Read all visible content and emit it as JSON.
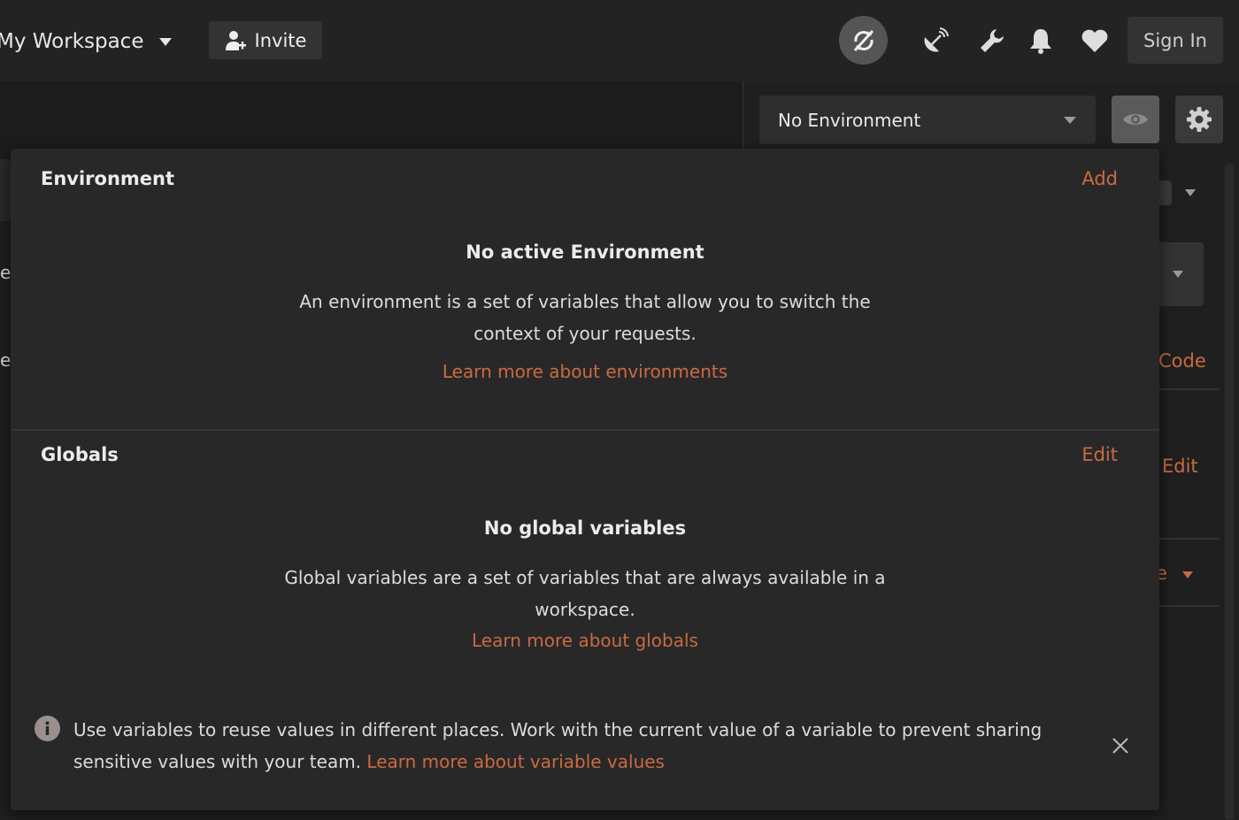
{
  "header": {
    "workspace_name": "My Workspace",
    "invite_label": "Invite",
    "signin_label": "Sign In"
  },
  "environment_bar": {
    "selected_environment": "No Environment"
  },
  "background_peek": {
    "code_label": "Code",
    "edit_label": "Edit",
    "left_char_1": "e",
    "left_char_2": "e",
    "right_char": "e"
  },
  "panel": {
    "environment": {
      "title": "Environment",
      "action": "Add",
      "empty_title": "No active Environment",
      "empty_desc": "An environment is a set of variables that allow you to switch the context of your requests.",
      "learn_link": "Learn more about environments"
    },
    "globals": {
      "title": "Globals",
      "action": "Edit",
      "empty_title": "No global variables",
      "empty_desc": "Global variables are a set of variables that are always available in a workspace.",
      "learn_link": "Learn more about globals"
    },
    "info": {
      "text": "Use variables to reuse values in different places. Work with the current value of a variable to prevent sharing sensitive values with your team.",
      "link": "Learn more about variable values"
    }
  },
  "colors": {
    "accent": "#c96a42",
    "panel_bg": "#282828",
    "app_bg": "#1f1f1f"
  }
}
